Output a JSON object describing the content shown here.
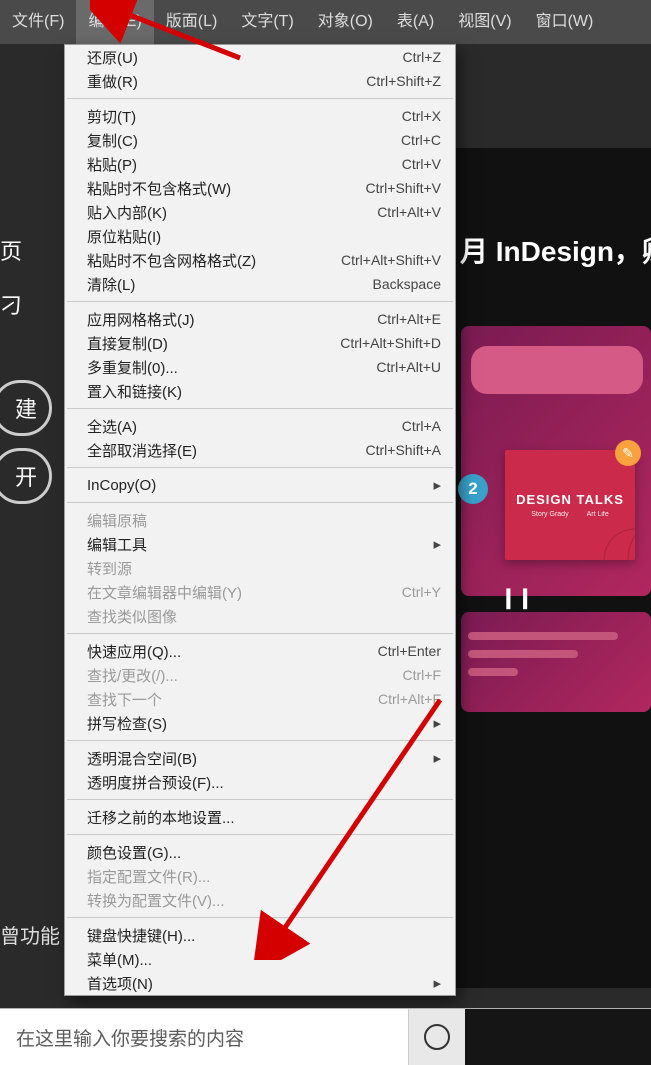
{
  "menubar": {
    "items": [
      {
        "label": "文件(F)"
      },
      {
        "label": "编辑(E)"
      },
      {
        "label": "版面(L)"
      },
      {
        "label": "文字(T)"
      },
      {
        "label": "对象(O)"
      },
      {
        "label": "表(A)"
      },
      {
        "label": "视图(V)"
      },
      {
        "label": "窗口(W)"
      }
    ],
    "selected_index": 1
  },
  "right": {
    "title_fragment": "月 InDesign，卿",
    "card_title": "DESIGN TALKS",
    "card_sub1": "Story Grady",
    "card_sub2": "Art Life",
    "play_label": "2",
    "pause_glyph": "❙❙"
  },
  "left": {
    "pill1": "建",
    "pill2": "开",
    "page_char": "页",
    "bracket_char": "刁",
    "bottom_label": "曾功能"
  },
  "taskbar": {
    "search_placeholder": "在这里输入你要搜索的内容"
  },
  "menu": [
    {
      "type": "item",
      "label": "还原(U)",
      "shortcut": "Ctrl+Z"
    },
    {
      "type": "item",
      "label": "重做(R)",
      "shortcut": "Ctrl+Shift+Z"
    },
    {
      "type": "sep"
    },
    {
      "type": "item",
      "label": "剪切(T)",
      "shortcut": "Ctrl+X"
    },
    {
      "type": "item",
      "label": "复制(C)",
      "shortcut": "Ctrl+C"
    },
    {
      "type": "item",
      "label": "粘贴(P)",
      "shortcut": "Ctrl+V"
    },
    {
      "type": "item",
      "label": "粘贴时不包含格式(W)",
      "shortcut": "Ctrl+Shift+V"
    },
    {
      "type": "item",
      "label": "贴入内部(K)",
      "shortcut": "Ctrl+Alt+V"
    },
    {
      "type": "item",
      "label": "原位粘贴(I)"
    },
    {
      "type": "item",
      "label": "粘贴时不包含网格格式(Z)",
      "shortcut": "Ctrl+Alt+Shift+V"
    },
    {
      "type": "item",
      "label": "清除(L)",
      "shortcut": "Backspace"
    },
    {
      "type": "sep"
    },
    {
      "type": "item",
      "label": "应用网格格式(J)",
      "shortcut": "Ctrl+Alt+E"
    },
    {
      "type": "item",
      "label": "直接复制(D)",
      "shortcut": "Ctrl+Alt+Shift+D"
    },
    {
      "type": "item",
      "label": "多重复制(0)...",
      "shortcut": "Ctrl+Alt+U"
    },
    {
      "type": "item",
      "label": "置入和链接(K)"
    },
    {
      "type": "sep"
    },
    {
      "type": "item",
      "label": "全选(A)",
      "shortcut": "Ctrl+A"
    },
    {
      "type": "item",
      "label": "全部取消选择(E)",
      "shortcut": "Ctrl+Shift+A"
    },
    {
      "type": "sep"
    },
    {
      "type": "sub",
      "label": "InCopy(O)"
    },
    {
      "type": "sep"
    },
    {
      "type": "item",
      "label": "编辑原稿",
      "disabled": true
    },
    {
      "type": "sub",
      "label": "编辑工具"
    },
    {
      "type": "item",
      "label": "转到源",
      "disabled": true
    },
    {
      "type": "item",
      "label": "在文章编辑器中编辑(Y)",
      "shortcut": "Ctrl+Y",
      "disabled": true
    },
    {
      "type": "item",
      "label": "查找类似图像",
      "disabled": true
    },
    {
      "type": "sep"
    },
    {
      "type": "item",
      "label": "快速应用(Q)...",
      "shortcut": "Ctrl+Enter"
    },
    {
      "type": "item",
      "label": "查找/更改(/)...",
      "shortcut": "Ctrl+F",
      "disabled": true
    },
    {
      "type": "item",
      "label": "查找下一个",
      "shortcut": "Ctrl+Alt+F",
      "disabled": true
    },
    {
      "type": "sub",
      "label": "拼写检查(S)"
    },
    {
      "type": "sep"
    },
    {
      "type": "sub",
      "label": "透明混合空间(B)"
    },
    {
      "type": "item",
      "label": "透明度拼合预设(F)..."
    },
    {
      "type": "sep"
    },
    {
      "type": "item",
      "label": "迁移之前的本地设置..."
    },
    {
      "type": "sep"
    },
    {
      "type": "item",
      "label": "颜色设置(G)..."
    },
    {
      "type": "item",
      "label": "指定配置文件(R)...",
      "disabled": true
    },
    {
      "type": "item",
      "label": "转换为配置文件(V)...",
      "disabled": true
    },
    {
      "type": "sep"
    },
    {
      "type": "item",
      "label": "键盘快捷键(H)..."
    },
    {
      "type": "item",
      "label": "菜单(M)..."
    },
    {
      "type": "sub",
      "label": "首选项(N)"
    }
  ]
}
